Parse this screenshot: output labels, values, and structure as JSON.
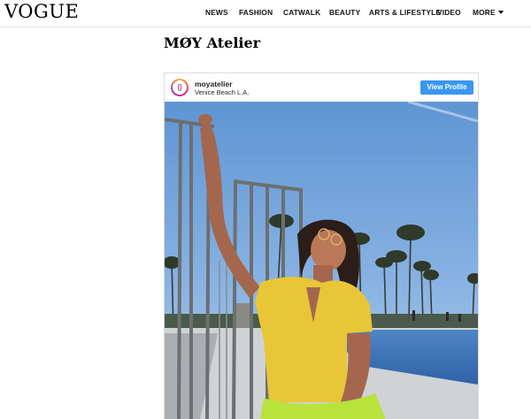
{
  "site": {
    "logo": "VOGUE"
  },
  "nav": {
    "items": [
      "NEWS",
      "FASHION",
      "CATWALK",
      "BEAUTY",
      "ARTS & LIFESTYLE",
      "VIDEO",
      "MORE"
    ]
  },
  "article": {
    "title": "MØY Atelier"
  },
  "embed": {
    "username": "moyatelier",
    "location": "Venice Beach L.A.",
    "view_profile_label": "View Profile"
  },
  "colors": {
    "accent_button": "#3897f0",
    "sky": "#6fa2d9",
    "top_yellow": "#e9c73a",
    "skirt_green": "#b6e23a"
  },
  "icons": {
    "dropdown": "chevron-down-icon",
    "avatar": "instagram-avatar-icon"
  }
}
